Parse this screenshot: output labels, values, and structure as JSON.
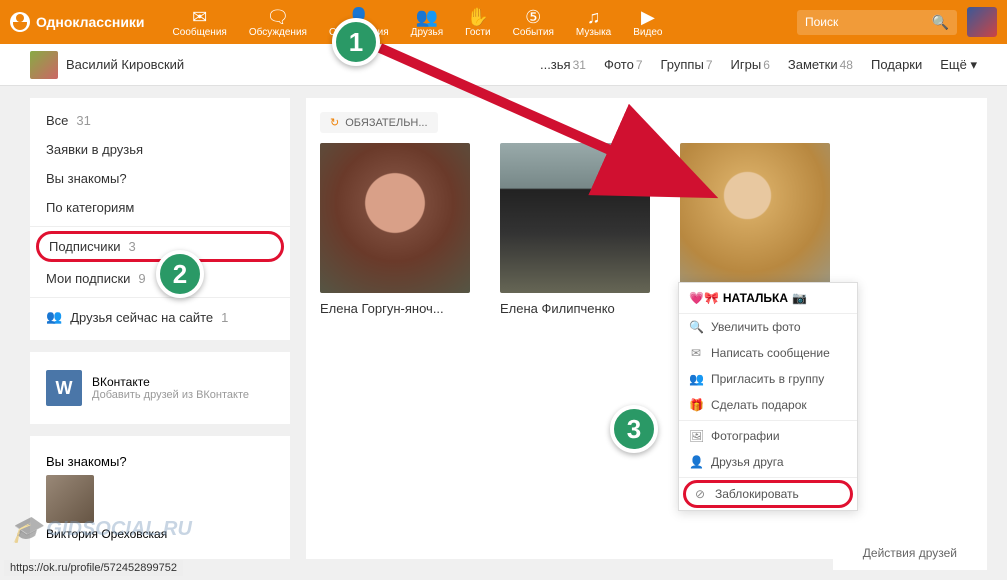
{
  "site": {
    "name": "Одноклассники"
  },
  "nav": [
    {
      "icon": "✉",
      "label": "Сообщения"
    },
    {
      "icon": "🗨",
      "label": "Обсуждения"
    },
    {
      "icon": "👤",
      "label": "Оповещения"
    },
    {
      "icon": "👥",
      "label": "Друзья"
    },
    {
      "icon": "✋",
      "label": "Гости"
    },
    {
      "icon": "⑤",
      "label": "События"
    },
    {
      "icon": "♫",
      "label": "Музыка"
    },
    {
      "icon": "▶",
      "label": "Видео"
    }
  ],
  "search": {
    "placeholder": "Поиск"
  },
  "profile": {
    "name": "Василий Кировский"
  },
  "subnav": [
    {
      "label": "...зья",
      "count": "31"
    },
    {
      "label": "Фото",
      "count": "7"
    },
    {
      "label": "Группы",
      "count": "7"
    },
    {
      "label": "Игры",
      "count": "6"
    },
    {
      "label": "Заметки",
      "count": "48"
    },
    {
      "label": "Подарки",
      "count": ""
    },
    {
      "label": "Ещё ▾",
      "count": ""
    }
  ],
  "sidebar": {
    "items": [
      {
        "label": "Все",
        "count": "31"
      },
      {
        "label": "Заявки в друзья",
        "count": ""
      },
      {
        "label": "Вы знакомы?",
        "count": ""
      },
      {
        "label": "По категориям",
        "count": ""
      },
      {
        "label": "Подписчики",
        "count": "3"
      },
      {
        "label": "Мои подписки",
        "count": "9"
      }
    ],
    "online": {
      "label": "Друзья сейчас на сайте",
      "count": "1"
    },
    "vk": {
      "title": "ВКонтакте",
      "sub": "Добавить друзей из ВКонтакте"
    },
    "suggest": {
      "title": "Вы знакомы?",
      "name": "Виктория Ореховская"
    }
  },
  "main": {
    "tag": "ОБЯЗАТЕЛЬН...",
    "friends": [
      {
        "name": "Елена Горгун-яноч..."
      },
      {
        "name": "Елена Филипченко"
      },
      {
        "name": ""
      }
    ]
  },
  "context": {
    "title": "НАТАЛЬКА",
    "items": [
      {
        "icon": "🔍",
        "label": "Увеличить фото"
      },
      {
        "icon": "✉",
        "label": "Написать сообщение"
      },
      {
        "icon": "👥",
        "label": "Пригласить в группу"
      },
      {
        "icon": "🎁",
        "label": "Сделать подарок"
      },
      {
        "icon": "🖼",
        "label": "Фотографии"
      },
      {
        "icon": "👤",
        "label": "Друзья друга"
      },
      {
        "icon": "⊘",
        "label": "Заблокировать"
      }
    ]
  },
  "badges": {
    "b1": "1",
    "b2": "2",
    "b3": "3"
  },
  "footer": {
    "actions": "Действия друзей"
  },
  "status_url": "https://ok.ru/profile/572452899752",
  "watermark": "GIDSOCIAL.RU"
}
